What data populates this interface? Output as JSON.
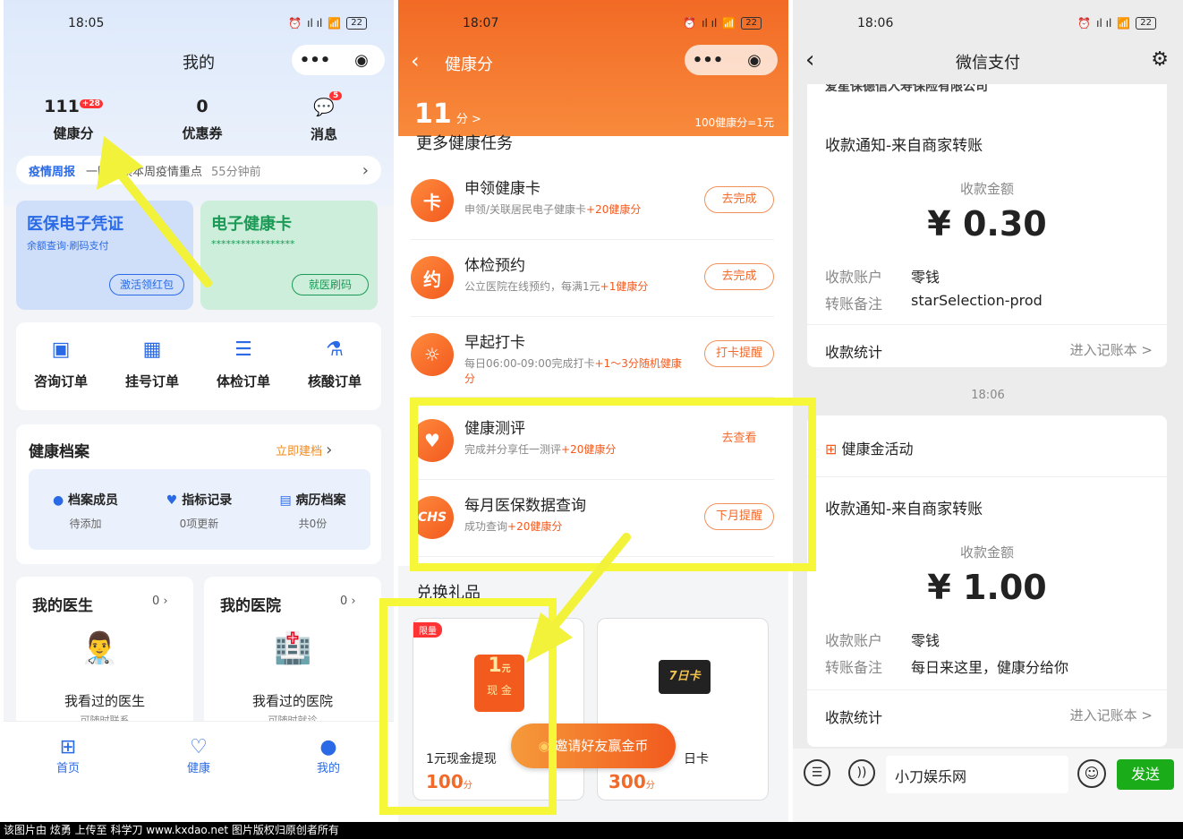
{
  "phone1": {
    "time": "18:05",
    "title": "我的",
    "stats": [
      {
        "num": "111",
        "badge": "+28",
        "label": "健康分"
      },
      {
        "num": "0",
        "label": "优惠券"
      },
      {
        "badge": "5",
        "label": "消息"
      }
    ],
    "news": {
      "tag": "疫情周报",
      "text": "一图速读本周疫情重点",
      "time": "55分钟前"
    },
    "card_insurance": {
      "title": "医保电子凭证",
      "sub": "余额查询·刷码支付",
      "button": "激活领红包"
    },
    "card_health": {
      "title": "电子健康卡",
      "stars": "*****************",
      "button": "就医刷码"
    },
    "orders": [
      "咨询订单",
      "挂号订单",
      "体检订单",
      "核酸订单"
    ],
    "records": {
      "title": "健康档案",
      "action": "立即建档",
      "items": [
        {
          "title": "档案成员",
          "sub": "待添加"
        },
        {
          "title": "指标记录",
          "sub": "0项更新"
        },
        {
          "title": "病历档案",
          "sub": "共0份"
        }
      ]
    },
    "doctor": {
      "title": "我的医生",
      "count": "0",
      "seen": "我看过的医生",
      "more": "可随时联系"
    },
    "hospital": {
      "title": "我的医院",
      "count": "0",
      "seen": "我看过的医院",
      "more": "可随时就诊"
    },
    "tabs": [
      "首页",
      "健康",
      "我的"
    ]
  },
  "phone2": {
    "time": "18:07",
    "title": "健康分",
    "score": "11",
    "score_unit": "分 >",
    "rate": "100健康分=1元",
    "section": "更多健康任务",
    "tasks": [
      {
        "icon": "卡",
        "title": "申领健康卡",
        "desc": "申领/关联居民电子健康卡",
        "bonus": "+20健康分",
        "button": "去完成"
      },
      {
        "icon": "约",
        "title": "体检预约",
        "desc": "公立医院在线预约，每满1元",
        "bonus": "+1健康分",
        "button": "去完成"
      },
      {
        "icon": "☼",
        "title": "早起打卡",
        "desc": "每日06:00-09:00完成打卡",
        "bonus": "+1～3分随机健康分",
        "button": "打卡提醒"
      },
      {
        "icon": "♥",
        "title": "健康测评",
        "desc": "完成并分享任一测评",
        "bonus": "+20健康分",
        "button": "去查看"
      },
      {
        "icon": "CHS",
        "title": "每月医保数据查询",
        "desc": "成功查询",
        "bonus": "+20健康分",
        "button": "下月提醒"
      }
    ],
    "gifts_title": "兑换礼品",
    "gifts": [
      {
        "tag": "限量",
        "amount": "1",
        "amount_unit": "元",
        "sub": "现 金",
        "name": "1元现金提现",
        "points": "100",
        "unit": "分"
      },
      {
        "badge": "7日卡",
        "name": "日卡",
        "points": "300",
        "unit": "分"
      }
    ],
    "invite": "邀请好友赢金币"
  },
  "phone3": {
    "time": "18:06",
    "title": "微信支付",
    "cut_text": "爱星保德信人寿保险有限公司",
    "msg1": {
      "title": "收款通知-来自商家转账",
      "amount_label": "收款金额",
      "amount": "¥ 0.30",
      "account_label": "收款账户",
      "account": "零钱",
      "note_label": "转账备注",
      "note": "starSelection-prod",
      "stats": "收款统计",
      "link": "进入记账本 >"
    },
    "divider_time": "18:06",
    "activity": "健康金活动",
    "msg2": {
      "title": "收款通知-来自商家转账",
      "amount_label": "收款金额",
      "amount": "¥ 1.00",
      "account_label": "收款账户",
      "account": "零钱",
      "note_label": "转账备注",
      "note": "每日来这里，健康分给你",
      "stats": "收款统计",
      "link": "进入记账本 >"
    },
    "input_text": "小刀娱乐网",
    "send": "发送"
  },
  "footer": "该图片由 炫勇 上传至 科学刀 www.kxdao.net 图片版权归原创者所有",
  "colors": {
    "blue": "#2a6ae6",
    "orange": "#f25a1e",
    "green": "#1aad19",
    "highlight": "#f7f73a"
  }
}
